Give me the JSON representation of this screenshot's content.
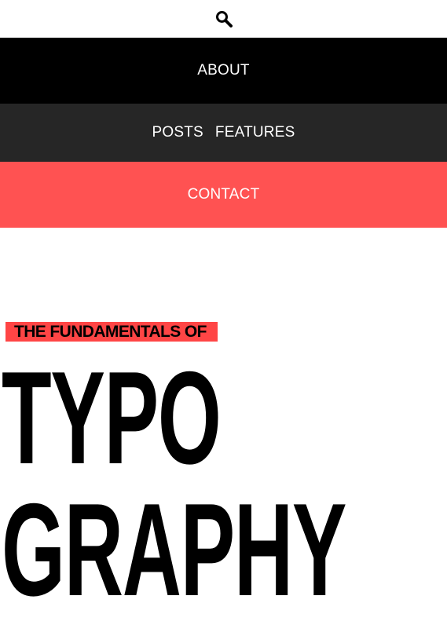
{
  "header": {
    "search_icon": "search-icon"
  },
  "nav": {
    "about": "ABOUT",
    "posts": "POSTS",
    "features": "FEATURES",
    "contact": "CONTACT"
  },
  "hero": {
    "kicker": "THE FUNDAMENTALS OF",
    "title_line1": "TYPO",
    "title_line2": "GRAPHY"
  },
  "colors": {
    "nav_about_bg": "#000000",
    "nav_mid_bg": "#262626",
    "accent": "#ff5252"
  }
}
